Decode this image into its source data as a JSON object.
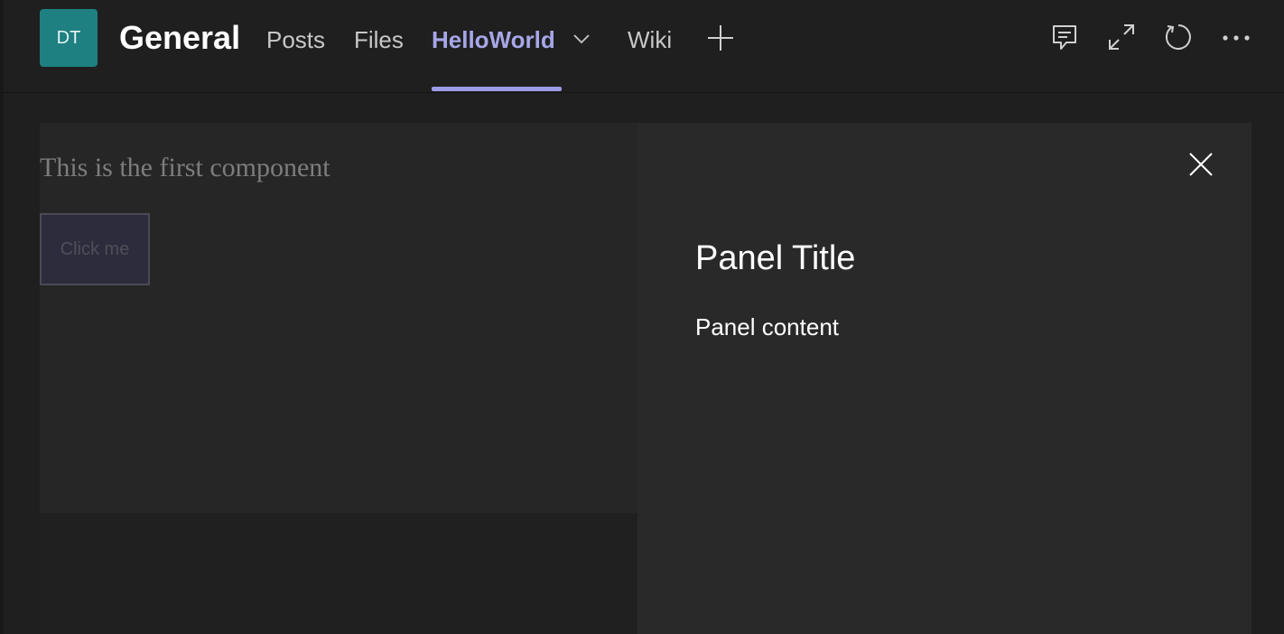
{
  "header": {
    "avatar_initials": "DT",
    "channel_title": "General",
    "tabs": [
      {
        "label": "Posts"
      },
      {
        "label": "Files"
      },
      {
        "label": "HelloWorld",
        "active": true
      },
      {
        "label": "Wiki"
      }
    ],
    "icons": [
      "add-tab-icon",
      "conversation-icon",
      "expand-icon",
      "refresh-icon",
      "more-options-icon"
    ]
  },
  "content": {
    "component_text": "This is the first component",
    "button_label": "Click me"
  },
  "panel": {
    "title": "Panel Title",
    "content": "Panel content",
    "close_icon": "close-icon"
  },
  "colors": {
    "accent": "#9c9ce6",
    "avatar_bg": "#1e8080",
    "background": "#1f1f1f",
    "panel_bg": "#292929"
  }
}
